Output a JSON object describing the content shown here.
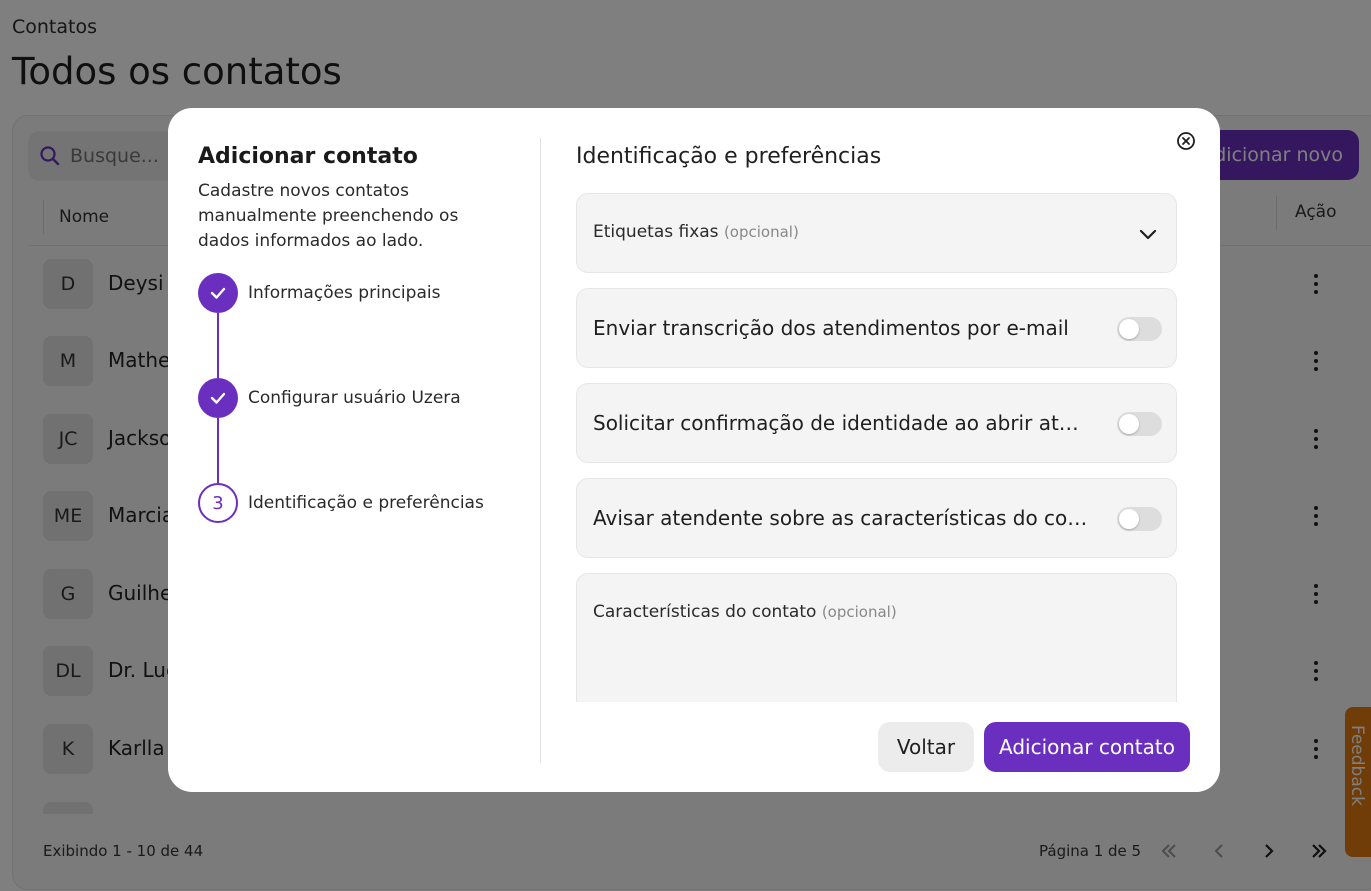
{
  "page": {
    "breadcrumb": "Contatos",
    "title": "Todos os contatos",
    "search_placeholder": "Busque...",
    "add_new_label": "Adicionar novo",
    "columns": {
      "name": "Nome",
      "action": "Ação"
    },
    "rows": [
      {
        "initials": "D",
        "name": "Deysi"
      },
      {
        "initials": "M",
        "name": "Mathe"
      },
      {
        "initials": "JC",
        "name": "Jackso"
      },
      {
        "initials": "ME",
        "name": "Marcia"
      },
      {
        "initials": "G",
        "name": "Guilhe"
      },
      {
        "initials": "DL",
        "name": "Dr. Luc"
      },
      {
        "initials": "K",
        "name": "Karlla"
      }
    ],
    "showing": "Exibindo 1 - 10 de 44",
    "page_info": "Página 1 de 5",
    "feedback_label": "Feedback"
  },
  "modal": {
    "title": "Adicionar contato",
    "description": "Cadastre novos contatos manualmente preenchendo os dados informados ao lado.",
    "steps": [
      {
        "label": "Informações principais",
        "status": "done"
      },
      {
        "label": "Configurar usuário Uzera",
        "status": "done"
      },
      {
        "label": "Identificação e preferências",
        "status": "current",
        "number": "3"
      }
    ],
    "section_title": "Identificação e preferências",
    "fixed_tags": {
      "label": "Etiquetas fixas",
      "optional": "(opcional)"
    },
    "toggles": [
      {
        "label": "Enviar transcrição dos atendimentos por e-mail",
        "on": false
      },
      {
        "label": "Solicitar confirmação de identidade ao abrir atendi...",
        "on": false
      },
      {
        "label": "Avisar atendente sobre as características do contato",
        "on": false
      }
    ],
    "characteristics": {
      "label": "Características do contato",
      "optional": "(opcional)"
    },
    "back_label": "Voltar",
    "submit_label": "Adicionar contato"
  },
  "colors": {
    "accent": "#6b2fc0",
    "overlay": "rgba(0,0,0,0.5)",
    "feedback": "#e07a10"
  }
}
